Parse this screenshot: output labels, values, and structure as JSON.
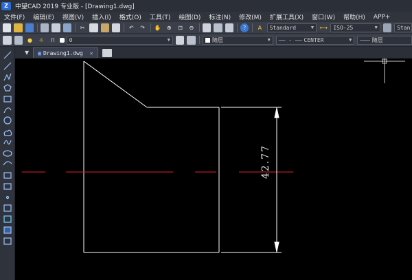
{
  "window": {
    "title": "中望CAD 2019 专业版 - [Drawing1.dwg]"
  },
  "menu": [
    "文件(F)",
    "编辑(E)",
    "视图(V)",
    "插入(I)",
    "格式(O)",
    "工具(T)",
    "绘图(D)",
    "标注(N)",
    "修改(M)",
    "扩展工具(X)",
    "窗口(W)",
    "帮助(H)",
    "APP+"
  ],
  "toolbar": {
    "text_style": "Standard",
    "dim_style": "ISO-25",
    "table_style": "Stan"
  },
  "layerbar": {
    "layer_number": "0",
    "color": "随层",
    "linetype": "CENTER",
    "lineweight": "随层"
  },
  "tabs": [
    {
      "label": "Drawing1.dwg"
    }
  ],
  "drawing": {
    "dimension_value": "42.77",
    "colors": {
      "outline": "#ffffff",
      "centerline": "#e0202a",
      "background": "#000000"
    }
  }
}
